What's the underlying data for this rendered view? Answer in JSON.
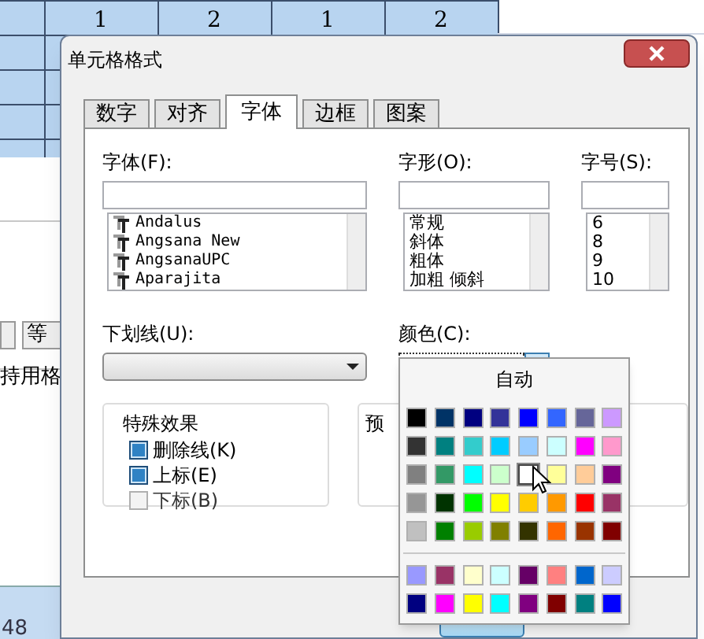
{
  "spreadsheet": {
    "header_numbers": [
      "1",
      "2",
      "1",
      "2"
    ],
    "toolbar_button": "等",
    "toolbar_text": "持用格",
    "cell_value": "48"
  },
  "dialog": {
    "title": "单元格格式",
    "tabs": [
      {
        "label": "数字",
        "selected": false
      },
      {
        "label": "对齐",
        "selected": false
      },
      {
        "label": "字体",
        "selected": true
      },
      {
        "label": "边框",
        "selected": false
      },
      {
        "label": "图案",
        "selected": false
      }
    ],
    "font": {
      "label": "字体(F):",
      "items": [
        "Andalus",
        "Angsana New",
        "AngsanaUPC",
        "Aparajita"
      ]
    },
    "style": {
      "label": "字形(O):",
      "items": [
        "常规",
        "斜体",
        "粗体",
        "加粗 倾斜"
      ]
    },
    "size": {
      "label": "字号(S):",
      "items": [
        "6",
        "8",
        "9",
        "10"
      ]
    },
    "underline": {
      "label": "下划线(U):"
    },
    "color": {
      "label": "颜色(C):"
    },
    "effects": {
      "title": "特殊效果",
      "options": [
        {
          "label": "删除线(K)",
          "checked": true
        },
        {
          "label": "上标(E)",
          "checked": true
        },
        {
          "label": "下标(B)",
          "checked": false
        }
      ]
    },
    "preview": {
      "title": "预"
    }
  },
  "color_menu": {
    "automatic": "自动",
    "swatches": [
      {
        "color": "#000000",
        "selected": false
      },
      {
        "color": "#003366",
        "selected": false
      },
      {
        "color": "#000080",
        "selected": false
      },
      {
        "color": "#333399",
        "selected": false
      },
      {
        "color": "#0000ff",
        "selected": false
      },
      {
        "color": "#3366ff",
        "selected": false
      },
      {
        "color": "#666699",
        "selected": false
      },
      {
        "color": "#cc99ff",
        "selected": false
      },
      {
        "color": "#333333",
        "selected": false
      },
      {
        "color": "#008080",
        "selected": false
      },
      {
        "color": "#33cccc",
        "selected": false
      },
      {
        "color": "#00ccff",
        "selected": false
      },
      {
        "color": "#99ccff",
        "selected": false
      },
      {
        "color": "#ccffff",
        "selected": false
      },
      {
        "color": "#ff00ff",
        "selected": false
      },
      {
        "color": "#ff99cc",
        "selected": false
      },
      {
        "color": "#808080",
        "selected": false
      },
      {
        "color": "#339966",
        "selected": false
      },
      {
        "color": "#00ffff",
        "selected": false
      },
      {
        "color": "#ccffcc",
        "selected": false
      },
      {
        "color": "#ffffff",
        "selected": true
      },
      {
        "color": "#ffff99",
        "selected": false
      },
      {
        "color": "#ffcc99",
        "selected": false
      },
      {
        "color": "#800080",
        "selected": false
      },
      {
        "color": "#969696",
        "selected": false
      },
      {
        "color": "#003300",
        "selected": false
      },
      {
        "color": "#00ff00",
        "selected": false
      },
      {
        "color": "#ffff00",
        "selected": false
      },
      {
        "color": "#ffcc00",
        "selected": false
      },
      {
        "color": "#ff9900",
        "selected": false
      },
      {
        "color": "#ff0000",
        "selected": false
      },
      {
        "color": "#993366",
        "selected": false
      },
      {
        "color": "#c0c0c0",
        "selected": false
      },
      {
        "color": "#008000",
        "selected": false
      },
      {
        "color": "#99cc00",
        "selected": false
      },
      {
        "color": "#808000",
        "selected": false
      },
      {
        "color": "#333300",
        "selected": false
      },
      {
        "color": "#ff6600",
        "selected": false
      },
      {
        "color": "#993300",
        "selected": false
      },
      {
        "color": "#800000",
        "selected": false
      }
    ],
    "extra_swatches": [
      {
        "color": "#9999ff",
        "selected": false
      },
      {
        "color": "#993366",
        "selected": false
      },
      {
        "color": "#ffffcc",
        "selected": false
      },
      {
        "color": "#ccffff",
        "selected": false
      },
      {
        "color": "#660066",
        "selected": false
      },
      {
        "color": "#ff8080",
        "selected": false
      },
      {
        "color": "#0066cc",
        "selected": false
      },
      {
        "color": "#ccccff",
        "selected": false
      },
      {
        "color": "#000080",
        "selected": false
      },
      {
        "color": "#ff00ff",
        "selected": false
      },
      {
        "color": "#ffff00",
        "selected": false
      },
      {
        "color": "#00ffff",
        "selected": false
      },
      {
        "color": "#800080",
        "selected": false
      },
      {
        "color": "#800000",
        "selected": false
      },
      {
        "color": "#008080",
        "selected": false
      },
      {
        "color": "#0000ff",
        "selected": false
      }
    ]
  }
}
